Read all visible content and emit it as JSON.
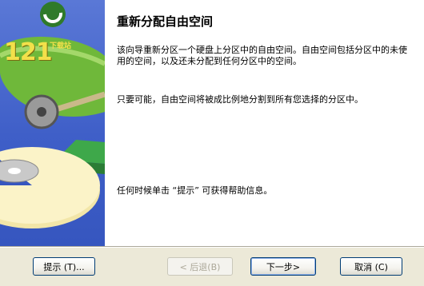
{
  "side_panel": {
    "logo_number": "121",
    "logo_tagline": "下载站"
  },
  "main": {
    "title": "重新分配自由空间",
    "paragraph_1": "该向导重新分区一个硬盘上分区中的自由空间。自由空间包括分区中的未使用的空间，以及还未分配到任何分区中的空间。",
    "paragraph_2": "只要可能，自由空间将被成比例地分割到所有您选择的分区中。",
    "paragraph_3": "任何时候单击 “提示” 可获得帮助信息。"
  },
  "footer": {
    "help_label": "提示 (T)...",
    "back_label": "< 后退(B)",
    "next_label": "下一步>",
    "cancel_label": "取消 (C)"
  },
  "colors": {
    "panel_blue": "#3f5fc8",
    "button_border": "#003c74",
    "dialog_bg": "#ece9d8"
  }
}
